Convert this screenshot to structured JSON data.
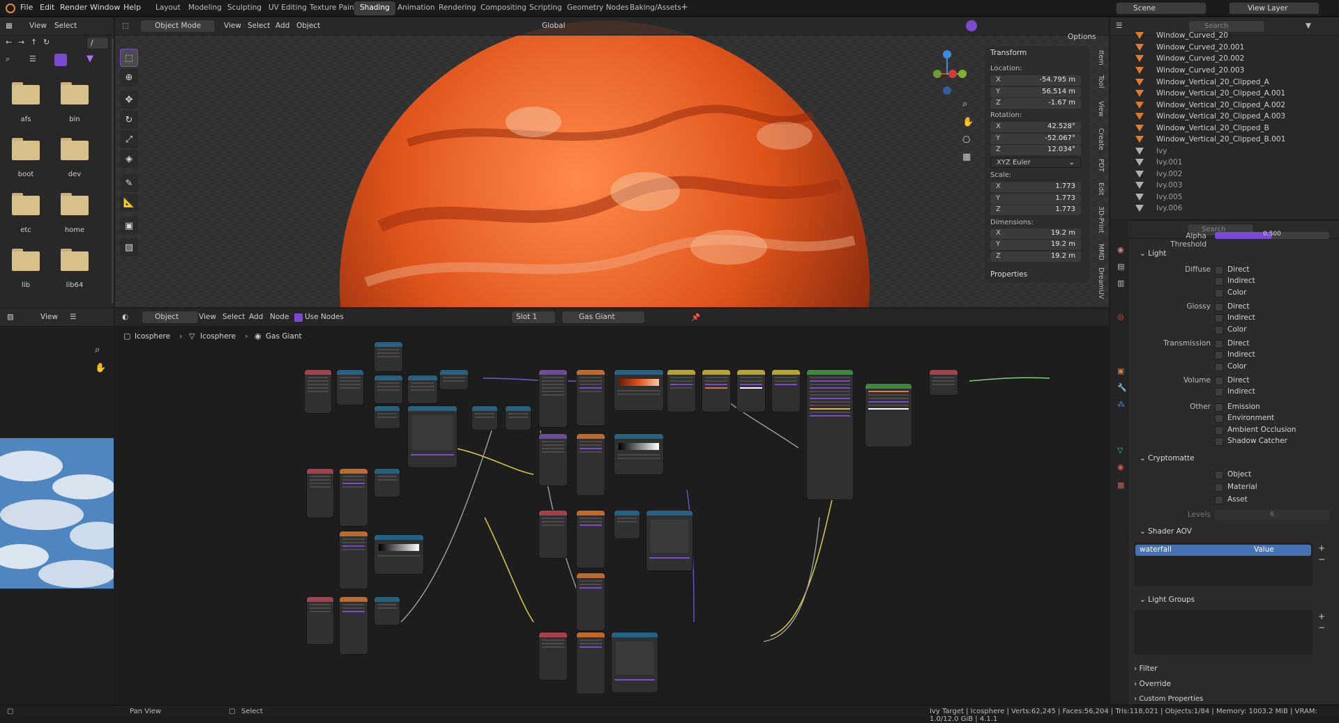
{
  "menu": [
    "File",
    "Edit",
    "Render",
    "Window",
    "Help"
  ],
  "workspaces": [
    "Layout",
    "Modeling",
    "Sculpting",
    "UV Editing",
    "Texture Paint",
    "Shading",
    "Animation",
    "Rendering",
    "Compositing",
    "Scripting",
    "Geometry Nodes",
    "Baking/Assets"
  ],
  "active_workspace": "Shading",
  "scene": "Scene",
  "view_layer": "View Layer",
  "file_browser": {
    "header": [
      "View",
      "Select"
    ],
    "path": "/",
    "folders": [
      "afs",
      "bin",
      "boot",
      "dev",
      "etc",
      "home",
      "lib",
      "lib64"
    ]
  },
  "viewport": {
    "mode": "Object Mode",
    "menus": [
      "View",
      "Select",
      "Add",
      "Object"
    ],
    "orientation": "Global",
    "options": "Options",
    "transform": {
      "title": "Transform",
      "location_label": "Location:",
      "location": [
        {
          "axis": "X",
          "value": "-54.795 m"
        },
        {
          "axis": "Y",
          "value": "56.514 m"
        },
        {
          "axis": "Z",
          "value": "-1.67 m"
        }
      ],
      "rotation_label": "Rotation:",
      "rotation": [
        {
          "axis": "X",
          "value": "42.528°"
        },
        {
          "axis": "Y",
          "value": "-52.067°"
        },
        {
          "axis": "Z",
          "value": "12.034°"
        }
      ],
      "rotation_mode": "XYZ Euler",
      "scale_label": "Scale:",
      "scale": [
        {
          "axis": "X",
          "value": "1.773"
        },
        {
          "axis": "Y",
          "value": "1.773"
        },
        {
          "axis": "Z",
          "value": "1.773"
        }
      ],
      "dimensions_label": "Dimensions:",
      "dimensions": [
        {
          "axis": "X",
          "value": "19.2 m"
        },
        {
          "axis": "Y",
          "value": "19.2 m"
        },
        {
          "axis": "Z",
          "value": "19.2 m"
        }
      ],
      "properties": "Properties"
    },
    "side_tabs": [
      "Item",
      "Tool",
      "View",
      "Create",
      "PDT",
      "Edit",
      "3D-Print",
      "MMD",
      "DreamUV"
    ]
  },
  "image_editor": {
    "header": [
      "View"
    ]
  },
  "node_editor": {
    "object": "Object",
    "menus": [
      "View",
      "Select",
      "Add",
      "Node"
    ],
    "use_nodes": "Use Nodes",
    "slot": "Slot 1",
    "material": "Gas Giant",
    "breadcrumb": [
      "Icosphere",
      "Icosphere",
      "Gas Giant"
    ]
  },
  "outliner": {
    "search_placeholder": "Search",
    "items": [
      "Window_Curved_20",
      "Window_Curved_20.001",
      "Window_Curved_20.002",
      "Window_Curved_20.003",
      "Window_Vertical_20_Clipped_A",
      "Window_Vertical_20_Clipped_A.001",
      "Window_Vertical_20_Clipped_A.002",
      "Window_Vertical_20_Clipped_A.003",
      "Window_Vertical_20_Clipped_B",
      "Window_Vertical_20_Clipped_B.001",
      "Ivy",
      "Ivy.001",
      "Ivy.002",
      "Ivy.003",
      "Ivy.005",
      "Ivy.006"
    ]
  },
  "properties": {
    "search_placeholder": "Search",
    "alpha_threshold": "Alpha Threshold",
    "alpha_value": "0.500",
    "light": {
      "title": "Light",
      "groups": [
        {
          "label": "Diffuse",
          "items": [
            "Direct",
            "Indirect",
            "Color"
          ]
        },
        {
          "label": "Glossy",
          "items": [
            "Direct",
            "Indirect",
            "Color"
          ]
        },
        {
          "label": "Transmission",
          "items": [
            "Direct",
            "Indirect",
            "Color"
          ]
        },
        {
          "label": "Volume",
          "items": [
            "Direct",
            "Indirect"
          ]
        },
        {
          "label": "Other",
          "items": [
            "Emission",
            "Environment",
            "Ambient Occlusion",
            "Shadow Catcher"
          ]
        }
      ]
    },
    "cryptomatte": {
      "title": "Cryptomatte",
      "items": [
        "Object",
        "Material",
        "Asset"
      ],
      "levels_label": "Levels",
      "levels": "6"
    },
    "shader_aov": {
      "title": "Shader AOV",
      "name": "waterfall",
      "type": "Value"
    },
    "light_groups": "Light Groups",
    "filter": "Filter",
    "override": "Override",
    "custom_properties": "Custom Properties"
  },
  "status": {
    "left": [
      "Pan View",
      "Select"
    ],
    "right": "Ivy Target | Icosphere | Verts:62,245 | Faces:56,204 | Tris:118,021 | Objects:1/84 | Memory: 1003.2 MiB | VRAM: 1.0/12.0 GiB | 4.1.1"
  },
  "colors": {
    "accent": "#7a4bd0",
    "selection": "#4772b3",
    "object_orange": "#e07a2f",
    "mesh_teal": "#2ec7a0"
  }
}
